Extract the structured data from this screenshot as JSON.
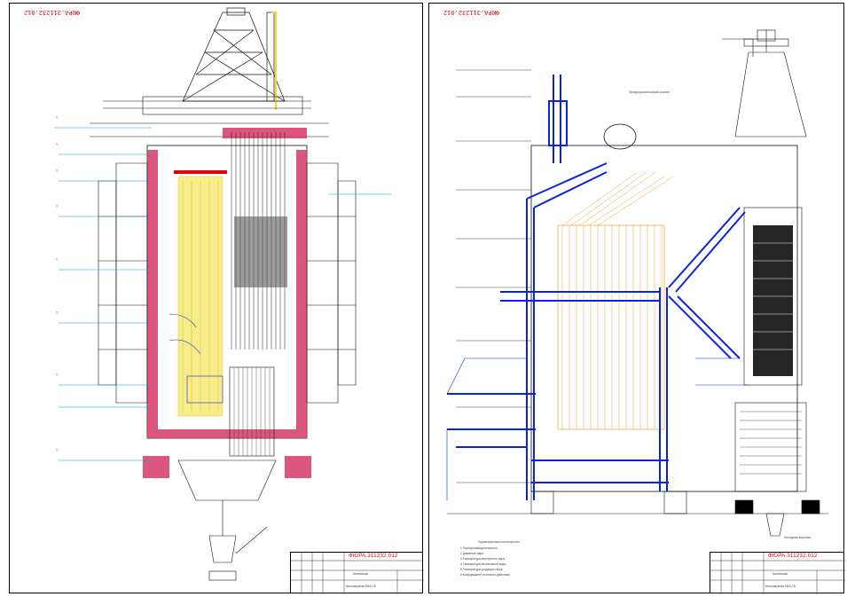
{
  "sheet_left": {
    "code": "ФЮРА.311232.012",
    "title_block": {
      "code": "ФЮРА.311232.012",
      "name": "Котельная",
      "sub": "Котлоагрегат БКЗ-75"
    }
  },
  "sheet_right": {
    "code": "ФЮРА.311232.012",
    "title_block": {
      "code": "ФЮРА.311232.012",
      "name": "Котельная",
      "sub": "Котлоагрегат БКЗ-75"
    },
    "callout_drum": "Предохранительный клапан",
    "callout_bottom": "Холодная воронка",
    "legend": {
      "title": "Характеристика котлоагрегата",
      "items": [
        "1 Паропроизводительность",
        "2 Давление пара",
        "3 Температура перегретого пара",
        "4 Температура питательной воды",
        "5 Температура уходящих газов",
        "6 Коэффициент полезного действия"
      ]
    }
  },
  "colors": {
    "frame": "#000000",
    "structure": "#1a1a1a",
    "water_wall": "#f2d833",
    "brick": "#d63a6a",
    "pipe_blue": "#0a24e0",
    "superheater_orange": "#f0a030",
    "red_line": "#e00000",
    "accent_cyan": "#00a0c8"
  }
}
